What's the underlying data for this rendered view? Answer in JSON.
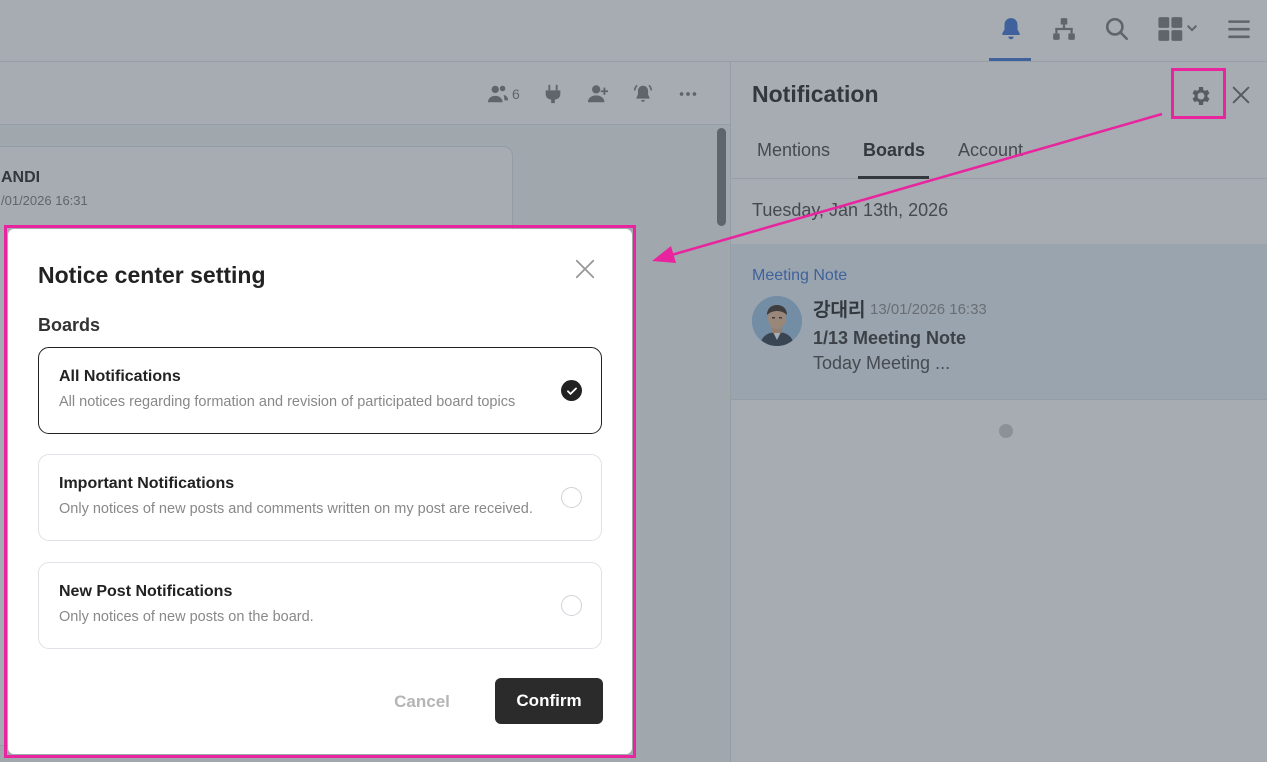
{
  "colors": {
    "accent": "#3b6fd6",
    "highlight": "#e8259e",
    "confirm_bg": "#2b2b2b",
    "notif_bg": "#e8f0fc"
  },
  "header": {
    "icons": [
      "bell-icon",
      "org-chart-icon",
      "search-icon",
      "apps-grid-icon",
      "menu-icon"
    ]
  },
  "chat": {
    "member_count": "6",
    "message": {
      "author": "ANDI",
      "time": "/01/2026 16:31"
    }
  },
  "panel": {
    "title": "Notification",
    "tabs": [
      {
        "label": "Mentions",
        "active": false
      },
      {
        "label": "Boards",
        "active": true
      },
      {
        "label": "Account",
        "active": false
      }
    ],
    "date": "Tuesday, Jan 13th, 2026",
    "notification": {
      "board": "Meeting Note",
      "author": "강대리",
      "time": "13/01/2026 16:33",
      "title": "1/13 Meeting Note",
      "preview": "Today Meeting ..."
    }
  },
  "modal": {
    "title": "Notice center setting",
    "section": "Boards",
    "options": [
      {
        "title": "All Notifications",
        "desc": "All notices regarding formation and revision of participated board topics",
        "selected": true
      },
      {
        "title": "Important Notifications",
        "desc": "Only notices of new posts and comments written on my post are received.",
        "selected": false
      },
      {
        "title": "New Post Notifications",
        "desc": "Only notices of new posts on the board.",
        "selected": false
      }
    ],
    "cancel_label": "Cancel",
    "confirm_label": "Confirm"
  }
}
